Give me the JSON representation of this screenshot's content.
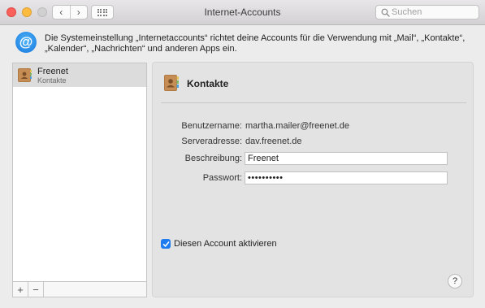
{
  "window": {
    "title": "Internet-Accounts",
    "back_icon": "‹",
    "forward_icon": "›",
    "search_placeholder": "Suchen"
  },
  "info": {
    "text": "Die Systemeinstellung „Internetaccounts“ richtet deine Accounts für die Verwendung mit „Mail“, „Kontakte“, „Kalender“, „Nachrichten“ und anderen Apps ein."
  },
  "sidebar": {
    "accounts": [
      {
        "name": "Freenet",
        "type": "Kontakte",
        "icon": "contacts-book-icon",
        "selected": true
      }
    ],
    "add_label": "+",
    "remove_label": "−"
  },
  "detail": {
    "title": "Kontakte",
    "icon": "contacts-book-icon",
    "username_label": "Benutzername:",
    "username_value": "martha.mailer@freenet.de",
    "server_label": "Serveradresse:",
    "server_value": "dav.freenet.de",
    "description_label": "Beschreibung:",
    "description_value": "Freenet",
    "password_label": "Passwort:",
    "password_value": "••••••••••",
    "enable_label": "Diesen Account aktivieren",
    "enable_checked": true,
    "help_label": "?"
  },
  "colors": {
    "accent": "#1f7cf0",
    "close": "#fc605b",
    "minimize": "#fdbc40",
    "zoom_disabled": "#d0d0d0"
  }
}
